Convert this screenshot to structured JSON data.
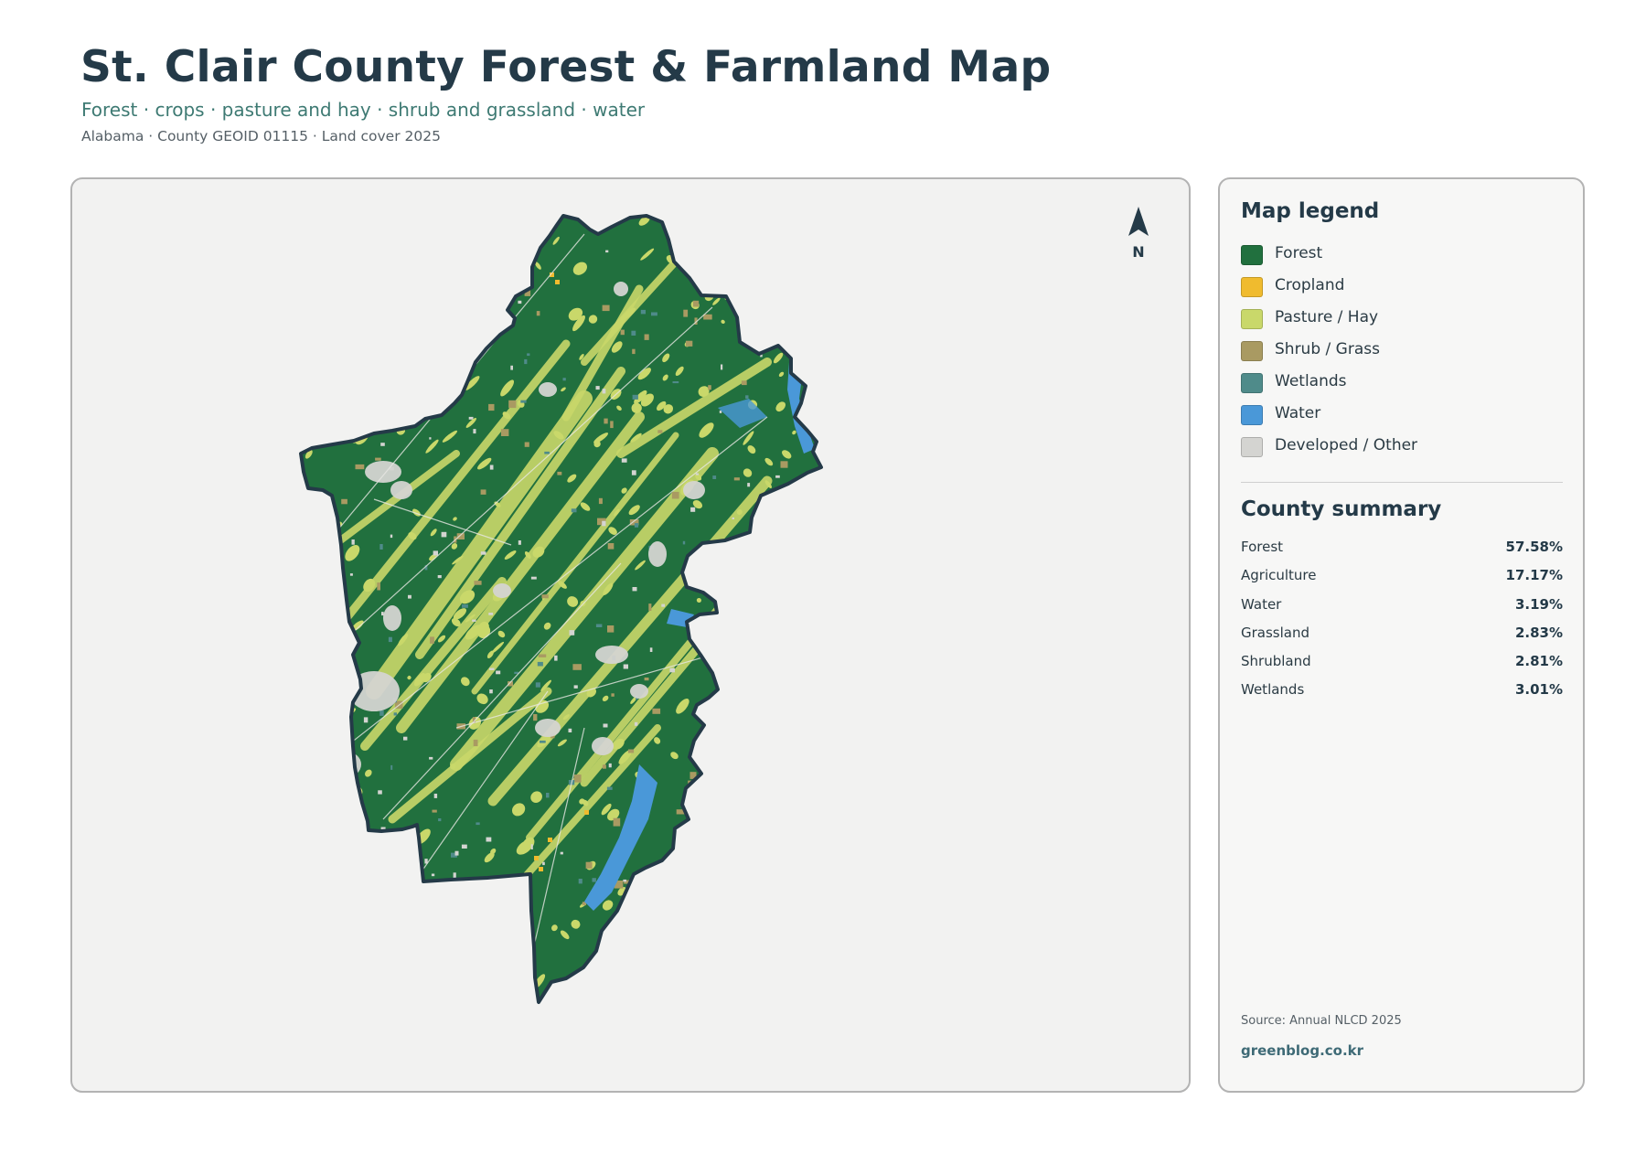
{
  "header": {
    "title": "St. Clair County Forest & Farmland Map",
    "subtitle": "Forest · crops · pasture and hay · shrub and grassland · water",
    "meta": "Alabama · County GEOID 01115 · Land cover 2025"
  },
  "map": {
    "north_label": "N",
    "colors": {
      "forest": "#21703e",
      "cropland": "#f0bb2e",
      "pasture": "#c9d86a",
      "shrub": "#a99a62",
      "wetlands": "#4f8b8a",
      "water": "#4a98d8",
      "developed": "#d4d4d1",
      "outline": "#243a48",
      "background": "#f2f2f1"
    }
  },
  "legend": {
    "title": "Map legend",
    "items": [
      {
        "label": "Forest",
        "color": "#21703e"
      },
      {
        "label": "Cropland",
        "color": "#f0bb2e"
      },
      {
        "label": "Pasture / Hay",
        "color": "#c9d86a"
      },
      {
        "label": "Shrub / Grass",
        "color": "#a99a62"
      },
      {
        "label": "Wetlands",
        "color": "#4f8b8a"
      },
      {
        "label": "Water",
        "color": "#4a98d8"
      },
      {
        "label": "Developed / Other",
        "color": "#d4d4d1"
      }
    ]
  },
  "summary": {
    "title": "County summary",
    "rows": [
      {
        "label": "Forest",
        "value": "57.58%"
      },
      {
        "label": "Agriculture",
        "value": "17.17%"
      },
      {
        "label": "Water",
        "value": "3.19%"
      },
      {
        "label": "Grassland",
        "value": "2.83%"
      },
      {
        "label": "Shrubland",
        "value": "2.81%"
      },
      {
        "label": "Wetlands",
        "value": "3.01%"
      }
    ]
  },
  "footer": {
    "source": "Source: Annual NLCD 2025",
    "credit": "greenblog.co.kr"
  }
}
